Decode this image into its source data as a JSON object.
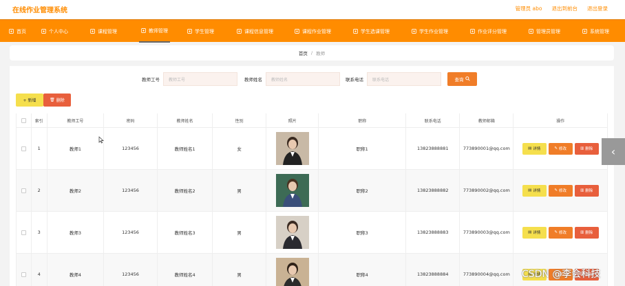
{
  "app": {
    "title": "在线作业管理系统"
  },
  "top_links": [
    "管理员 abo",
    "退出到前台",
    "退出登录"
  ],
  "nav": [
    {
      "label": "首页",
      "icon": "home-icon"
    },
    {
      "label": "个人中心",
      "icon": "user-icon"
    },
    {
      "label": "课程管理",
      "icon": "book-icon"
    },
    {
      "label": "教师管理",
      "icon": "teacher-icon",
      "active": true
    },
    {
      "label": "学生管理",
      "icon": "student-icon"
    },
    {
      "label": "课程信息管理",
      "icon": "info-icon"
    },
    {
      "label": "课程作业管理",
      "icon": "homework-icon"
    },
    {
      "label": "学生选课管理",
      "icon": "select-icon"
    },
    {
      "label": "学生作业管理",
      "icon": "work-icon"
    },
    {
      "label": "作业评分管理",
      "icon": "score-icon"
    },
    {
      "label": "管理员管理",
      "icon": "admin-icon"
    },
    {
      "label": "系统管理",
      "icon": "settings-icon"
    }
  ],
  "breadcrumb": {
    "home": "首页",
    "sep": "/",
    "current": "教师"
  },
  "search": {
    "fields": [
      {
        "label": "教师工号",
        "placeholder": "教师工号"
      },
      {
        "label": "教师姓名",
        "placeholder": "教师姓名"
      },
      {
        "label": "联系电话",
        "placeholder": "联系电话"
      }
    ],
    "button": "查询"
  },
  "toolbar": {
    "add": "+ 新增",
    "delete": "删除"
  },
  "table": {
    "columns": [
      "索引",
      "教师工号",
      "密码",
      "教师姓名",
      "性别",
      "照片",
      "职称",
      "联系电话",
      "教师邮箱",
      "操作"
    ],
    "rows": [
      {
        "index": "1",
        "id": "教师1",
        "password": "123456",
        "name": "教师姓名1",
        "gender": "女",
        "title": "职称1",
        "phone": "13823888881",
        "email": "773890001@qq.com"
      },
      {
        "index": "2",
        "id": "教师2",
        "password": "123456",
        "name": "教师姓名2",
        "gender": "男",
        "title": "职称2",
        "phone": "13823888882",
        "email": "773890002@qq.com"
      },
      {
        "index": "3",
        "id": "教师3",
        "password": "123456",
        "name": "教师姓名3",
        "gender": "男",
        "title": "职称3",
        "phone": "13823888883",
        "email": "773890003@qq.com"
      },
      {
        "index": "4",
        "id": "教师4",
        "password": "123456",
        "name": "教师姓名4",
        "gender": "男",
        "title": "职称4",
        "phone": "13823888884",
        "email": "773890004@qq.com"
      }
    ],
    "actions": {
      "detail": "详情",
      "edit": "修改",
      "delete": "删除"
    }
  },
  "watermark": "CSDN @李会科技",
  "colors": {
    "accent": "#ff8c00",
    "search_button": "#f07d28",
    "add_button": "#f5df4d",
    "delete_button": "#e85f3c"
  }
}
